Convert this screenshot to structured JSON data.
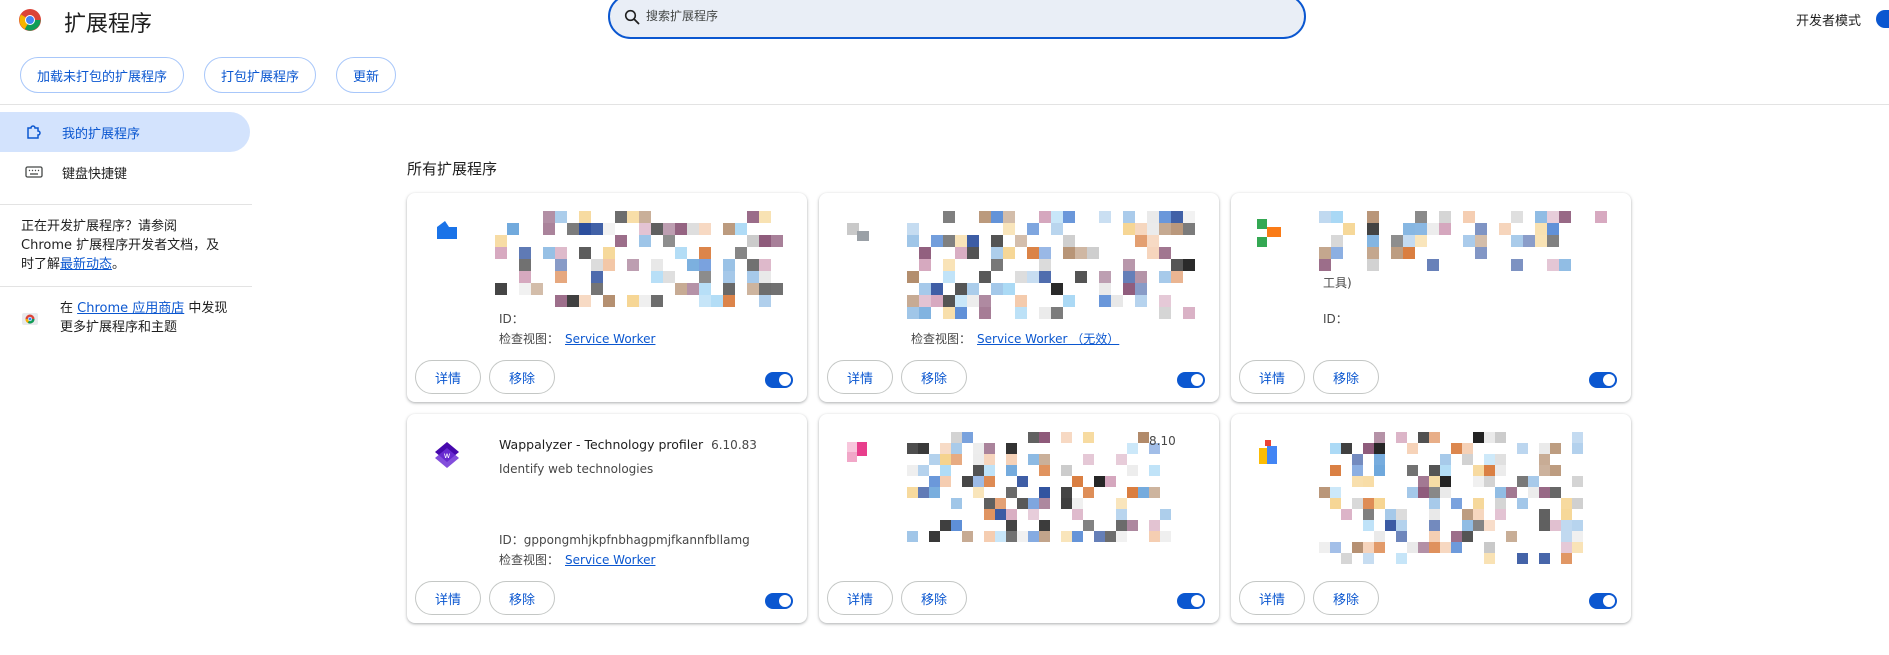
{
  "header": {
    "title": "扩展程序",
    "search_placeholder": "搜索扩展程序",
    "dev_mode_label": "开发者模式",
    "dev_mode_on": true
  },
  "toolbar": {
    "load_unpacked": "加载未打包的扩展程序",
    "pack": "打包扩展程序",
    "update": "更新"
  },
  "sidebar": {
    "items": [
      {
        "label": "我的扩展程序",
        "icon": "extension-icon",
        "active": true
      },
      {
        "label": "键盘快捷键",
        "icon": "keyboard-icon",
        "active": false
      }
    ],
    "dev_note_text": "正在开发扩展程序？请参阅 Chrome 扩展程序开发者文档，及时了解",
    "dev_note_link": "最新动态",
    "dev_note_end": "。",
    "store_prefix": "在 ",
    "store_link": "Chrome 应用商店",
    "store_suffix": " 中发现更多扩展程序和主题"
  },
  "main": {
    "section_title": "所有扩展程序",
    "details_label": "详情",
    "remove_label": "移除",
    "inspect_label": "检查视图：",
    "cards": [
      {
        "name": "",
        "version": "",
        "desc": "",
        "id": "ID：",
        "inspect_link": "Service Worker",
        "enabled": true,
        "icon": "blue-shape-icon"
      },
      {
        "name": "",
        "version": "",
        "desc": "",
        "id": "",
        "inspect_link": "Service Worker （无效）",
        "enabled": true,
        "icon": "gray-icon"
      },
      {
        "name": "",
        "version": "",
        "desc": "工具)",
        "id": "ID：",
        "inspect_link": "",
        "enabled": true,
        "icon": "multicolor-icon"
      },
      {
        "name": "Wappalyzer - Technology profiler",
        "version": "6.10.83",
        "desc": "Identify web technologies",
        "id": "ID：gppongmhjkpfnbhagpmjfkannfbllamg",
        "inspect_link": "Service Worker",
        "enabled": true,
        "icon": "wappalyzer-icon"
      },
      {
        "name": "",
        "version": "8.10",
        "desc": "",
        "id": "",
        "inspect_link": "",
        "enabled": true,
        "icon": "pink-icon"
      },
      {
        "name": "",
        "version": "",
        "desc": "",
        "id": "",
        "inspect_link": "",
        "enabled": true,
        "icon": "yellow-icon"
      }
    ]
  },
  "colors": {
    "accent": "#0b57d0",
    "active_bg": "#d3e3fd",
    "search_bg": "#e9eef6"
  }
}
